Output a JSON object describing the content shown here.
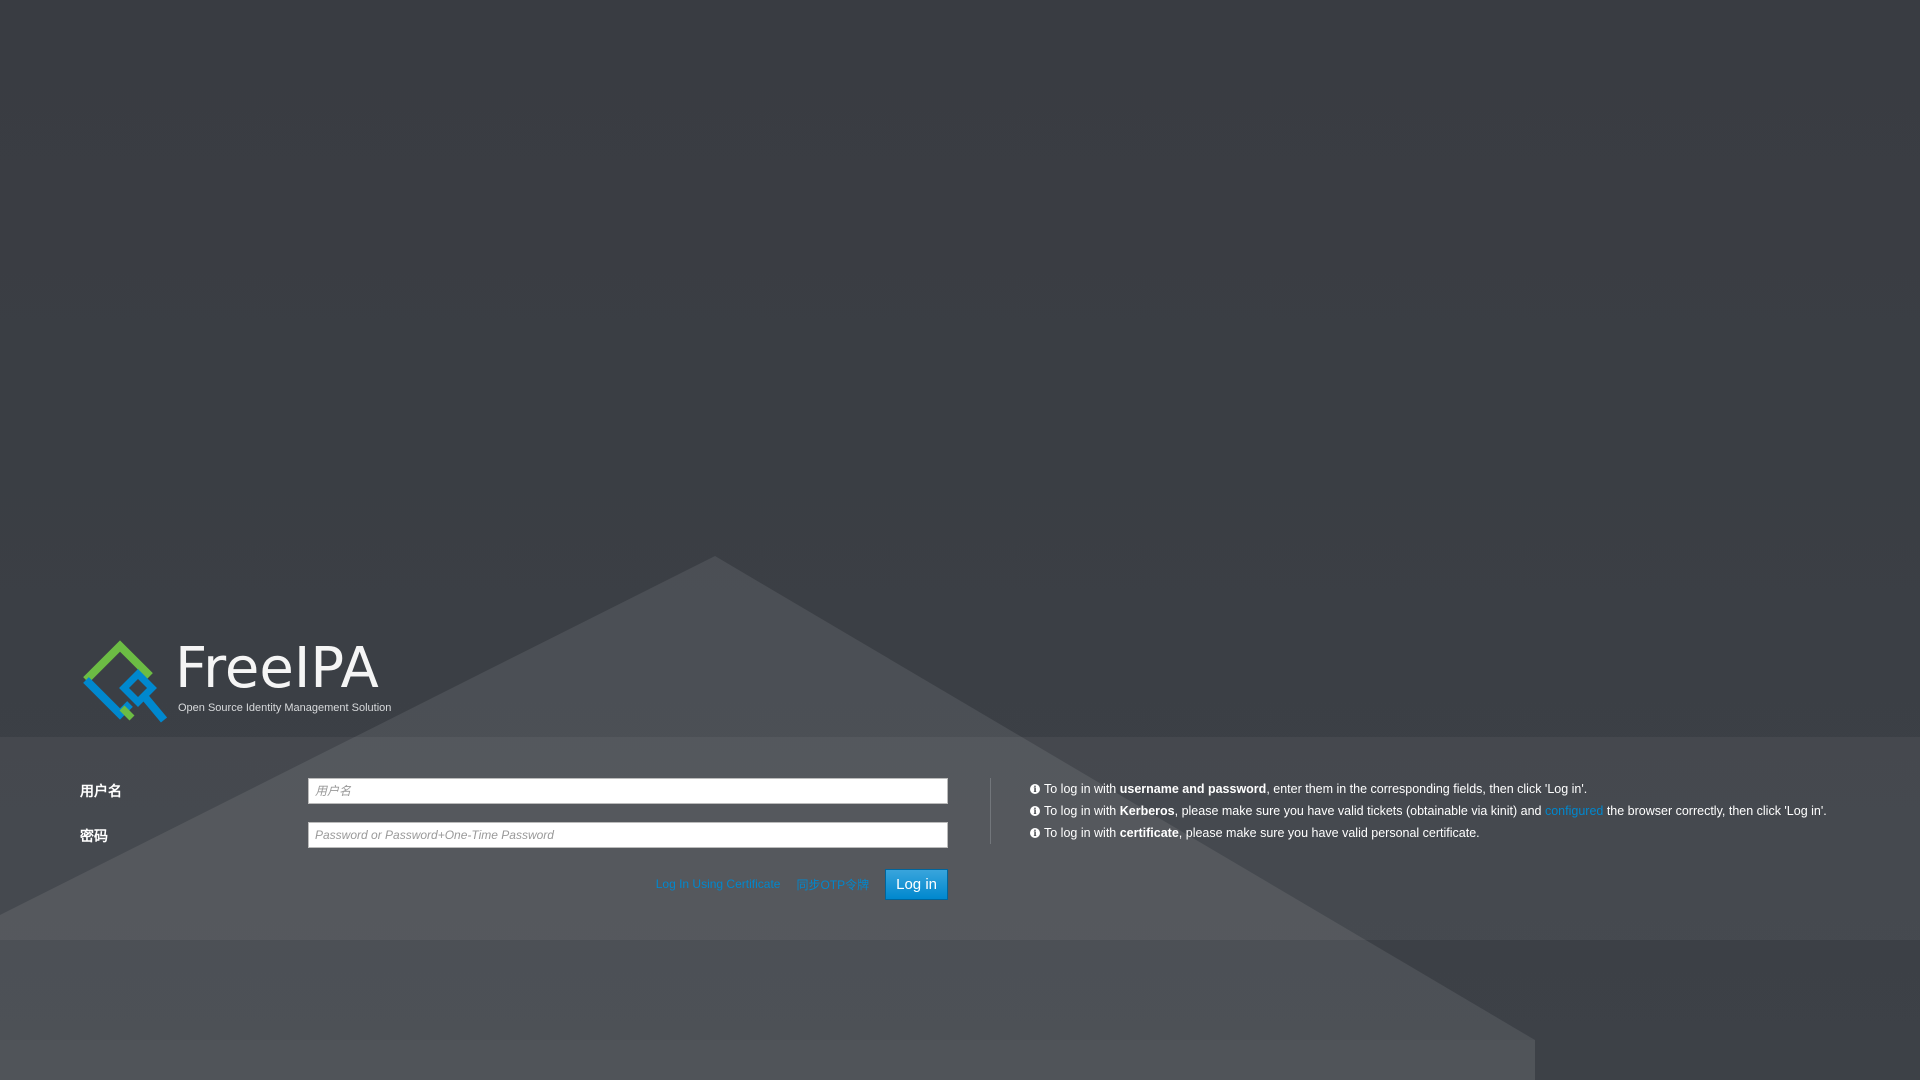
{
  "brand": {
    "name": "FreeIPA",
    "tagline": "Open Source Identity Management Solution",
    "colors": {
      "logo_green": "#6cbc44",
      "logo_blue": "#0088ce",
      "link": "#0088ce",
      "button": "#0088ce"
    }
  },
  "form": {
    "username": {
      "label": "用户名",
      "placeholder": "用户名",
      "value": ""
    },
    "password": {
      "label": "密码",
      "placeholder": "Password or Password+One-Time Password",
      "value": ""
    },
    "cert_link": "Log In Using Certificate",
    "otp_link": "同步OTP令牌",
    "login_button": "Log in"
  },
  "help": {
    "icon": "info-circle-icon",
    "item1": {
      "pre": "To log in with ",
      "bold": "username and password",
      "post": ", enter them in the corresponding fields, then click 'Log in'."
    },
    "item2": {
      "pre": "To log in with ",
      "bold": "Kerberos",
      "mid": ", please make sure you have valid tickets (obtainable via kinit) and ",
      "link": "configured",
      "post": " the browser correctly, then click 'Log in'."
    },
    "item3": {
      "pre": "To log in with ",
      "bold": "certificate",
      "post": ", please make sure you have valid personal certificate."
    }
  }
}
